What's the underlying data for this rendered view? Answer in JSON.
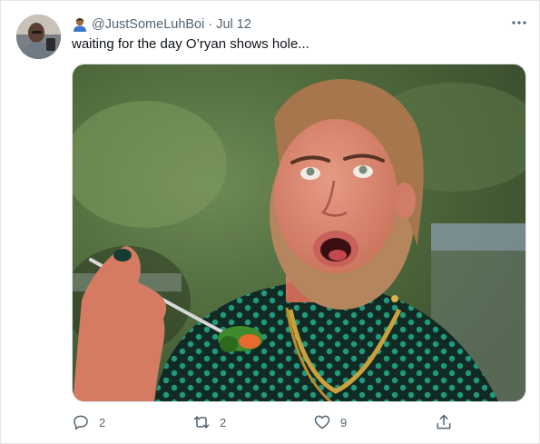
{
  "tweet": {
    "author_handle": "@JustSomeLuhBoi",
    "separator": "·",
    "date": "Jul 12",
    "text": "waiting for the day O’ryan shows hole...",
    "handle_emoji": "person-emoji",
    "avatar": "profile-photo",
    "media": "reaction-photo-woman-eating-salad-surprised"
  },
  "actions": {
    "reply_count": "2",
    "retweet_count": "2",
    "like_count": "9",
    "reply_icon": "reply-icon",
    "retweet_icon": "retweet-icon",
    "like_icon": "heart-icon",
    "share_icon": "share-icon",
    "more_icon": "more-icon"
  },
  "colors": {
    "text_primary": "#0f1419",
    "text_secondary": "#536471",
    "border": "#e6e6e6"
  }
}
